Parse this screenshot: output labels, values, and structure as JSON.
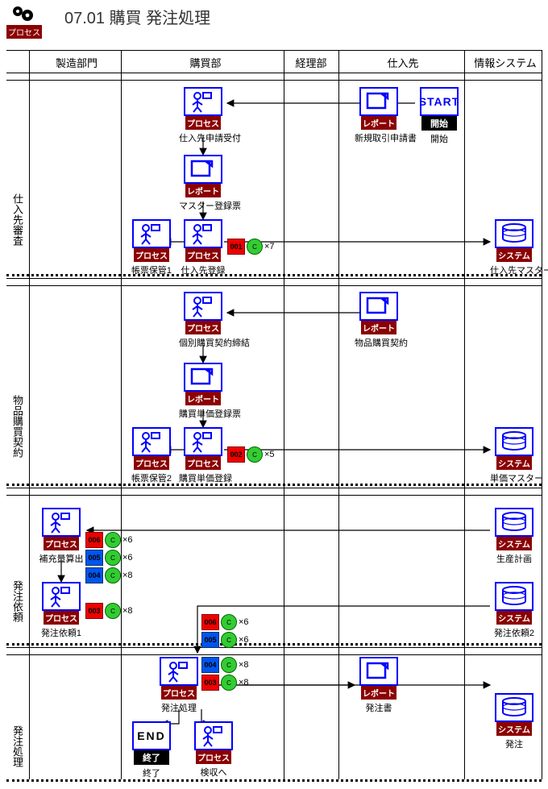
{
  "title": "07.01 購買 発注処理",
  "header_badge": "プロセス",
  "columns": [
    "製造部門",
    "購買部",
    "経理部",
    "仕入先",
    "情報システム"
  ],
  "phases": [
    "仕入先審査",
    "物品購買契約",
    "発注依頼",
    "発注処理"
  ],
  "badge": {
    "process": "プロセス",
    "report": "レポート",
    "system": "システム",
    "end": "終了",
    "start": "開始"
  },
  "labels": {
    "start": "START",
    "start_cap": "開始",
    "new_req": "新規取引申請書",
    "sup_accept": "仕入先申請受付",
    "master_form": "マスター登録票",
    "form_keep1": "帳票保管1",
    "sup_reg": "仕入先登録",
    "sup_master": "仕入先マスター",
    "ind_contract": "個別購買契約締結",
    "goods_contract": "物品購買契約",
    "price_form": "購買単価登録票",
    "form_keep2": "帳票保管2",
    "price_reg": "購買単価登録",
    "price_master": "単価マスター",
    "replenish": "補充量算出",
    "order_req1": "発注依頼1",
    "prod_plan": "生産計画",
    "order_req2": "発注依頼2",
    "order_proc": "発注処理",
    "order_doc": "発注書",
    "order_sys": "発注",
    "end": "END",
    "end_cap": "終了",
    "to_inspect": "検収へ"
  },
  "controls": {
    "c1": {
      "tag": "001",
      "n": "×7"
    },
    "c2": {
      "tag": "002",
      "n": "×5"
    },
    "c3": {
      "tag": "006",
      "n": "×6"
    },
    "c4": {
      "tag": "005",
      "n": "×6"
    },
    "c5": {
      "tag": "004",
      "n": "×8"
    },
    "c6": {
      "tag": "003",
      "n": "×8"
    },
    "c7": {
      "tag": "006",
      "n": "×6"
    },
    "c8": {
      "tag": "005",
      "n": "×6"
    },
    "c9": {
      "tag": "004",
      "n": "×8"
    },
    "c10": {
      "tag": "003",
      "n": "×8"
    }
  }
}
